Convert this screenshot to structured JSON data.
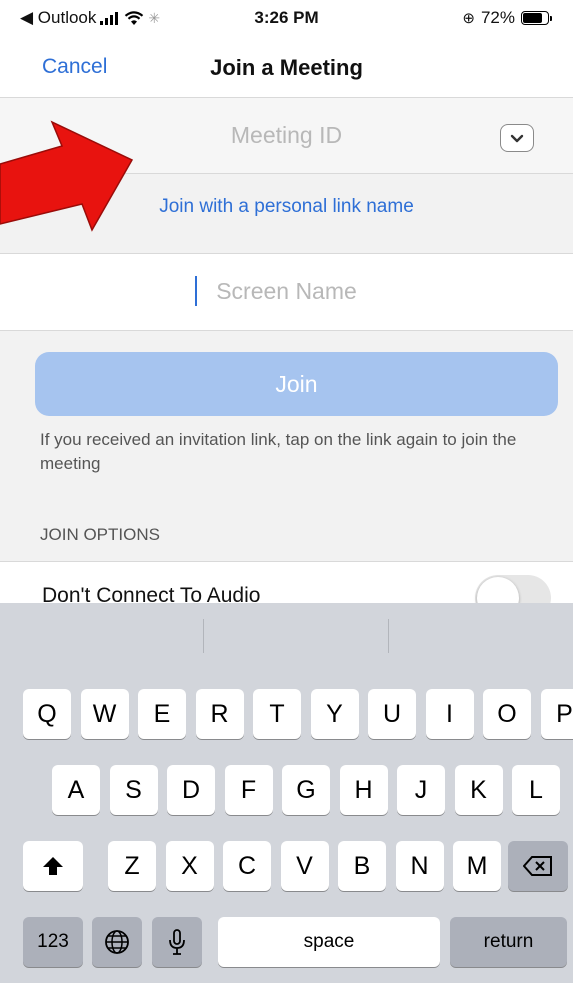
{
  "status_bar": {
    "back_app": "◀ Outlook",
    "time": "3:26 PM",
    "battery": "72%",
    "battery_level": 0.72
  },
  "nav": {
    "cancel_label": "Cancel",
    "title": "Join a Meeting"
  },
  "form": {
    "meeting_id_placeholder": "Meeting ID",
    "personal_link_label": "Join with a personal link name",
    "screen_name_placeholder": "Screen Name",
    "join_button_label": "Join",
    "hint_text": "If you received an invitation link, tap on the link again to join the meeting",
    "join_options_header": "JOIN OPTIONS",
    "dont_connect_audio_label": "Don't Connect To Audio",
    "dont_connect_audio_on": false
  },
  "keyboard": {
    "row1": [
      "Q",
      "W",
      "E",
      "R",
      "T",
      "Y",
      "U",
      "I",
      "O",
      "P"
    ],
    "row2": [
      "A",
      "S",
      "D",
      "F",
      "G",
      "H",
      "J",
      "K",
      "L"
    ],
    "row3": [
      "Z",
      "X",
      "C",
      "V",
      "B",
      "N",
      "M"
    ],
    "numbers_key": "123",
    "space_key": "space",
    "return_key": "return"
  },
  "colors": {
    "accent": "#2e6fd6",
    "join_button": "#a6c4ef",
    "arrow": "#e8130f",
    "keyboard_bg": "#d2d5db"
  },
  "icons": [
    "chevron-down-icon",
    "signal-icon",
    "wifi-icon",
    "battery-icon",
    "shift-icon",
    "backspace-icon",
    "globe-icon",
    "microphone-icon",
    "arrow-pointer"
  ]
}
